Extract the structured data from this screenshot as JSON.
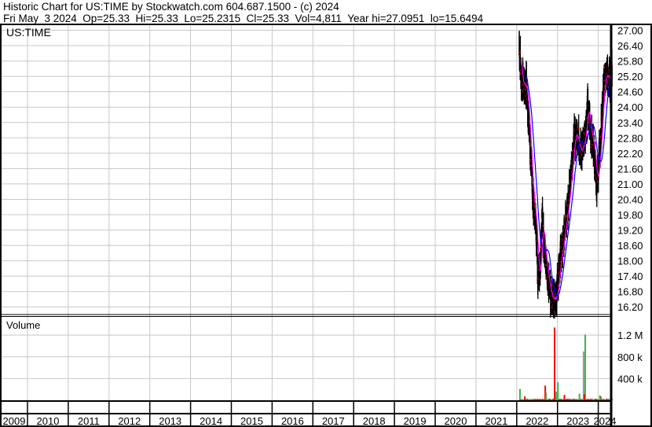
{
  "header": {
    "title": "Historic Chart for US:TIME by Stockwatch.com 604.687.1500 - (c) 2024",
    "quote": "Fri May  3 2024  Op=25.33  Hi=25.33  Lo=25.2315  Cl=25.33  Vol=4,811  Year hi=27.0951  lo=15.6494"
  },
  "chart_data": {
    "type": "line",
    "title": "US:TIME",
    "volume_label": "Volume",
    "x_ticks": [
      "2009",
      "2010",
      "2011",
      "2012",
      "2013",
      "2014",
      "2015",
      "2016",
      "2017",
      "2018",
      "2019",
      "2020",
      "2021",
      "2022",
      "2023",
      "2024"
    ],
    "price_ticks": [
      "27.00",
      "26.40",
      "25.80",
      "25.20",
      "24.60",
      "24.00",
      "23.40",
      "22.80",
      "22.20",
      "21.60",
      "21.00",
      "20.40",
      "19.80",
      "19.20",
      "18.60",
      "18.00",
      "17.40",
      "16.80",
      "16.20"
    ],
    "price_ylim": [
      15.9,
      27.2
    ],
    "volume_ticks": [
      "1.2 M",
      "800 k",
      "400 k"
    ],
    "volume_tick_values": [
      1200000,
      800000,
      400000
    ],
    "volume_ylim": [
      0,
      1550000
    ],
    "grid": true,
    "price_series": [
      [
        2022.06,
        26.5
      ],
      [
        2022.12,
        25.0
      ],
      [
        2022.24,
        24.8
      ],
      [
        2022.31,
        23.0
      ],
      [
        2022.39,
        20.5
      ],
      [
        2022.47,
        19.5
      ],
      [
        2022.52,
        17.5
      ],
      [
        2022.58,
        18.0
      ],
      [
        2022.62,
        19.8
      ],
      [
        2022.68,
        18.5
      ],
      [
        2022.75,
        17.3
      ],
      [
        2022.81,
        16.8
      ],
      [
        2022.91,
        16.5
      ],
      [
        2022.97,
        16.7
      ],
      [
        2023.05,
        17.8
      ],
      [
        2023.12,
        18.5
      ],
      [
        2023.2,
        19.5
      ],
      [
        2023.28,
        20.5
      ],
      [
        2023.33,
        21.5
      ],
      [
        2023.41,
        22.8
      ],
      [
        2023.49,
        23.0
      ],
      [
        2023.58,
        22.2
      ],
      [
        2023.66,
        22.8
      ],
      [
        2023.74,
        24.0
      ],
      [
        2023.82,
        23.0
      ],
      [
        2023.89,
        22.5
      ],
      [
        2023.97,
        21.0
      ],
      [
        2024.05,
        22.5
      ],
      [
        2024.12,
        24.5
      ],
      [
        2024.2,
        25.6
      ],
      [
        2024.28,
        25.0
      ],
      [
        2024.34,
        25.33
      ]
    ],
    "volume_spikes": [
      [
        2022.06,
        210000,
        "green"
      ],
      [
        2022.18,
        70000,
        "red"
      ],
      [
        2022.68,
        270000,
        "red"
      ],
      [
        2022.7,
        140000,
        "green"
      ],
      [
        2022.91,
        1340000,
        "red"
      ],
      [
        2022.95,
        160000,
        "green"
      ],
      [
        2022.99,
        330000,
        "green"
      ],
      [
        2023.15,
        100000,
        "red"
      ],
      [
        2023.52,
        120000,
        "green"
      ],
      [
        2023.62,
        900000,
        "gray"
      ],
      [
        2023.66,
        1210000,
        "green"
      ],
      [
        2023.64,
        110000,
        "red"
      ],
      [
        2024.04,
        70000,
        "red"
      ],
      [
        2024.02,
        90000,
        "green"
      ]
    ],
    "colors": {
      "bar": "#000000",
      "close": "#ff0000",
      "ma_short": "#ff00ff",
      "ma_long": "#0000ff",
      "vol_up": "#3cb44b",
      "vol_down": "#ff0000",
      "vol_gray": "#999999",
      "grid": "#c8c8c8"
    }
  }
}
